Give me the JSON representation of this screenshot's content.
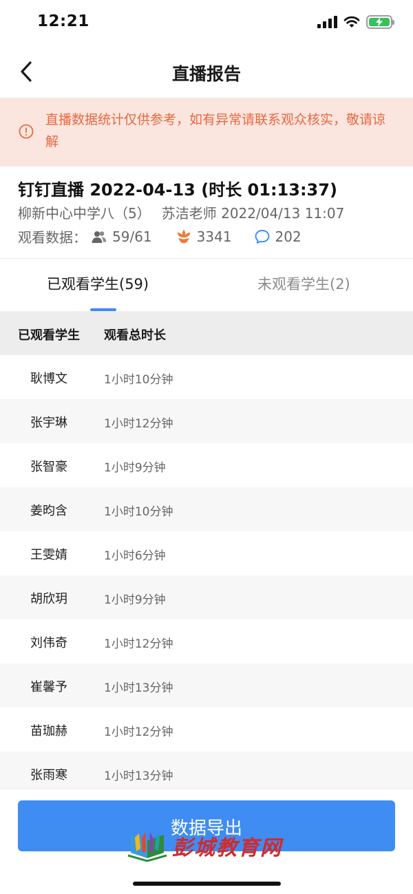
{
  "status_bar": {
    "time": "12:21"
  },
  "nav": {
    "title": "直播报告"
  },
  "notice": {
    "text": "直播数据统计仅供参考，如有异常请联系观众核实，敬请谅解"
  },
  "live": {
    "title": "钉钉直播 2022-04-13 (时长 01:13:37)",
    "class_name": "柳新中心中学八（5）",
    "teacher_datetime": "苏洁老师 2022/04/13 11:07",
    "stats_label": "观看数据：",
    "viewers": "59/61",
    "likes": "3341",
    "comments": "202"
  },
  "tabs": {
    "watched": "已观看学生(59)",
    "unwatched": "未观看学生(2)"
  },
  "table": {
    "headers": {
      "name": "已观看学生",
      "duration": "观看总时长"
    },
    "rows": [
      {
        "name": "耿博文",
        "duration": "1小时10分钟"
      },
      {
        "name": "张宇琳",
        "duration": "1小时12分钟"
      },
      {
        "name": "张智豪",
        "duration": "1小时9分钟"
      },
      {
        "name": "姜昀含",
        "duration": "1小时10分钟"
      },
      {
        "name": "王雯婧",
        "duration": "1小时6分钟"
      },
      {
        "name": "胡欣玥",
        "duration": "1小时9分钟"
      },
      {
        "name": "刘伟奇",
        "duration": "1小时12分钟"
      },
      {
        "name": "崔馨予",
        "duration": "1小时13分钟"
      },
      {
        "name": "苗珈赫",
        "duration": "1小时12分钟"
      },
      {
        "name": "张雨寒",
        "duration": "1小时13分钟"
      }
    ]
  },
  "export": {
    "label": "数据导出"
  },
  "watermark": {
    "text": "彭城教育网"
  },
  "colors": {
    "accent": "#3f8cf2",
    "notice_bg": "#fbe6df",
    "notice_text": "#e9673f",
    "like_icon": "#f07a3d",
    "comment_icon": "#3d8af7"
  },
  "icons": {
    "back": "chevron-left-icon",
    "notice": "alert-circle-icon",
    "viewers": "users-icon",
    "likes": "flower-icon",
    "comments": "chat-bubble-icon"
  }
}
